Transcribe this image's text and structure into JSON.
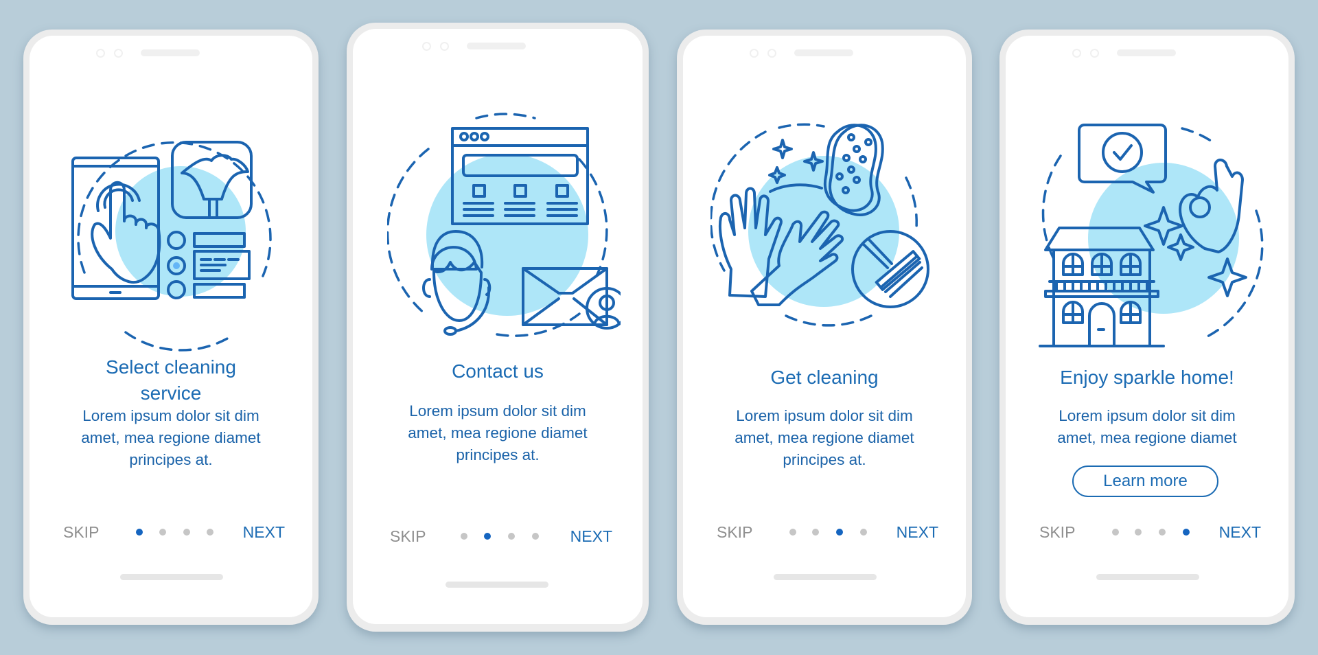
{
  "colors": {
    "background": "#b8cdd9",
    "primary": "#1b6bb3",
    "light_fill": "#aee6f8",
    "mid_fill": "#64b5f6",
    "muted_text": "#8f8f8f",
    "inactive_dot": "#c6c6c6"
  },
  "screens": [
    {
      "illustration": "select-service-illustration",
      "title": "Select cleaning service",
      "title_lines": [
        "Select cleaning",
        "service"
      ],
      "body_lines": [
        "Lorem ipsum dolor sit dim",
        "amet, mea regione diamet",
        "principes at."
      ],
      "skip_label": "SKIP",
      "next_label": "NEXT",
      "active_step": 1,
      "total_steps": 4
    },
    {
      "illustration": "contact-us-illustration",
      "title": "Contact us",
      "body_lines": [
        "Lorem ipsum dolor sit dim",
        "amet, mea regione diamet",
        "principes at."
      ],
      "skip_label": "SKIP",
      "next_label": "NEXT",
      "active_step": 2,
      "total_steps": 4
    },
    {
      "illustration": "get-cleaning-illustration",
      "title": "Get cleaning",
      "body_lines": [
        "Lorem ipsum dolor sit dim",
        "amet, mea regione diamet",
        "principes at."
      ],
      "skip_label": "SKIP",
      "next_label": "NEXT",
      "active_step": 3,
      "total_steps": 4
    },
    {
      "illustration": "sparkle-home-illustration",
      "title": "Enjoy sparkle home!",
      "body_lines": [
        "Lorem ipsum dolor sit dim",
        "amet, mea regione diamet"
      ],
      "button_label": "Learn more",
      "skip_label": "SKIP",
      "next_label": "NEXT",
      "active_step": 4,
      "total_steps": 4
    }
  ]
}
